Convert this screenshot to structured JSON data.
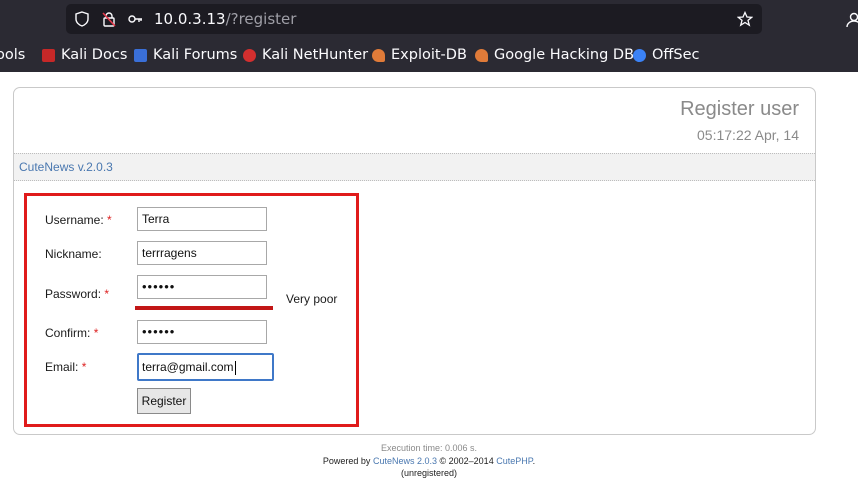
{
  "browser": {
    "url_host": "10.0.3.13",
    "url_path": "/?register",
    "bookmarks": [
      {
        "label": "ools",
        "icon": "tools-icon",
        "color": "#2b2a33"
      },
      {
        "label": "Kali Docs",
        "icon": "kali-docs-icon",
        "color": "#c62828"
      },
      {
        "label": "Kali Forums",
        "icon": "kali-forums-icon",
        "color": "#3a6fd8"
      },
      {
        "label": "Kali NetHunter",
        "icon": "kali-nethunter-icon",
        "color": "#d32f2f"
      },
      {
        "label": "Exploit-DB",
        "icon": "exploit-db-icon",
        "color": "#e07b39"
      },
      {
        "label": "Google Hacking DB",
        "icon": "google-hacking-db-icon",
        "color": "#e07b39"
      },
      {
        "label": "OffSec",
        "icon": "offsec-icon",
        "color": "#3b82f6"
      }
    ]
  },
  "page": {
    "title": "Register user",
    "time": "05:17:22 Apr, 14",
    "cutenews_version": "CuteNews v.2.0.3"
  },
  "form": {
    "username_label": "Username:",
    "username_value": "Terra",
    "nickname_label": "Nickname:",
    "nickname_value": "terrragens",
    "password_label": "Password:",
    "password_value": "••••••",
    "password_strength": "Very poor",
    "confirm_label": "Confirm:",
    "confirm_value": "••••••",
    "email_label": "Email:",
    "email_value": "terra@gmail.com",
    "required_marker": "*",
    "register_button": "Register"
  },
  "footer": {
    "execution": "Execution time: 0.006 s.",
    "powered_prefix": "Powered by",
    "cutenews_link": "CuteNews 2.0.3",
    "copyright": "© 2002–2014",
    "cutephp_link": "CutePHP",
    "period": ".",
    "unregistered": "(unregistered)"
  },
  "colors": {
    "chrome_bg": "#2b2a33",
    "highlight_box": "#e01b1b",
    "strength_bar": "#c21616",
    "link": "#4a78b0"
  }
}
